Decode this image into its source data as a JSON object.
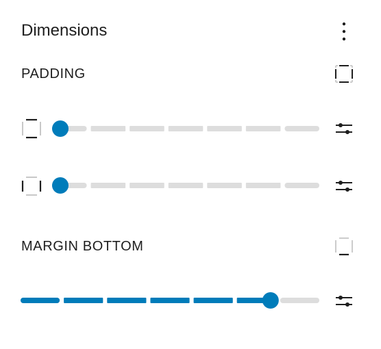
{
  "panel": {
    "title": "Dimensions",
    "menu_icon": "more-vertical-icon"
  },
  "padding": {
    "label": "PADDING",
    "link_sides_icon": "sides-all-icon",
    "rows": [
      {
        "side_icon": "sides-vertical-icon",
        "value_fraction": 0.0,
        "settings_icon": "settings-sliders-icon"
      },
      {
        "side_icon": "sides-horizontal-icon",
        "value_fraction": 0.0,
        "settings_icon": "settings-sliders-icon"
      }
    ]
  },
  "margin_bottom": {
    "label": "MARGIN BOTTOM",
    "side_icon": "side-bottom-icon",
    "value_fraction": 0.84,
    "settings_icon": "settings-sliders-icon"
  },
  "colors": {
    "accent": "#007cba",
    "track": "#dddddd",
    "text": "#1e1e1e",
    "icon_muted": "#bbbbbb"
  }
}
